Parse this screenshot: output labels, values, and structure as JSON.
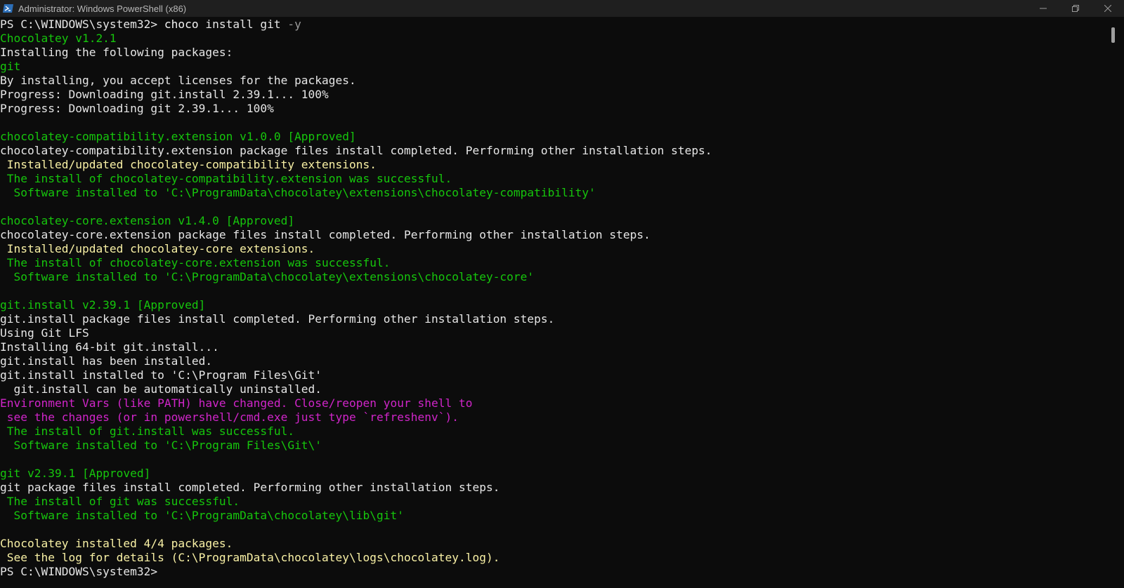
{
  "window": {
    "title": "Administrator: Windows PowerShell (x86)",
    "controls": {
      "minimize_icon": "minimize-icon",
      "restore_icon": "restore-icon",
      "close_icon": "close-icon"
    }
  },
  "colors": {
    "background": "#0c0c0c",
    "default_text": "#e6e6e6",
    "green": "#16c60c",
    "yellow": "#f9f1a5",
    "magenta": "#d025c9",
    "param": "#9a9a9a"
  },
  "console": {
    "lines": [
      {
        "segments": [
          {
            "text": "PS C:\\WINDOWS\\system32> ",
            "style": "default"
          },
          {
            "text": "choco",
            "style": "cmd"
          },
          {
            "text": " install git ",
            "style": "default"
          },
          {
            "text": "-y",
            "style": "param"
          }
        ]
      },
      {
        "segments": [
          {
            "text": "Chocolatey v1.2.1",
            "style": "green"
          }
        ]
      },
      {
        "segments": [
          {
            "text": "Installing the following packages:",
            "style": "default"
          }
        ]
      },
      {
        "segments": [
          {
            "text": "git",
            "style": "green"
          }
        ]
      },
      {
        "segments": [
          {
            "text": "By installing, you accept licenses for the packages.",
            "style": "default"
          }
        ]
      },
      {
        "segments": [
          {
            "text": "Progress: Downloading git.install 2.39.1... 100%",
            "style": "default"
          }
        ]
      },
      {
        "segments": [
          {
            "text": "Progress: Downloading git 2.39.1... 100%",
            "style": "default"
          }
        ]
      },
      {
        "segments": [
          {
            "text": "",
            "style": "default"
          }
        ]
      },
      {
        "segments": [
          {
            "text": "chocolatey-compatibility.extension v1.0.0 [Approved]",
            "style": "green"
          }
        ]
      },
      {
        "segments": [
          {
            "text": "chocolatey-compatibility.extension package files install completed. Performing other installation steps.",
            "style": "default"
          }
        ]
      },
      {
        "segments": [
          {
            "text": " Installed/updated chocolatey-compatibility extensions.",
            "style": "yellow"
          }
        ]
      },
      {
        "segments": [
          {
            "text": " The install of chocolatey-compatibility.extension was successful.",
            "style": "green"
          }
        ]
      },
      {
        "segments": [
          {
            "text": "  Software installed to 'C:\\ProgramData\\chocolatey\\extensions\\chocolatey-compatibility'",
            "style": "green"
          }
        ]
      },
      {
        "segments": [
          {
            "text": "",
            "style": "default"
          }
        ]
      },
      {
        "segments": [
          {
            "text": "chocolatey-core.extension v1.4.0 [Approved]",
            "style": "green"
          }
        ]
      },
      {
        "segments": [
          {
            "text": "chocolatey-core.extension package files install completed. Performing other installation steps.",
            "style": "default"
          }
        ]
      },
      {
        "segments": [
          {
            "text": " Installed/updated chocolatey-core extensions.",
            "style": "yellow"
          }
        ]
      },
      {
        "segments": [
          {
            "text": " The install of chocolatey-core.extension was successful.",
            "style": "green"
          }
        ]
      },
      {
        "segments": [
          {
            "text": "  Software installed to 'C:\\ProgramData\\chocolatey\\extensions\\chocolatey-core'",
            "style": "green"
          }
        ]
      },
      {
        "segments": [
          {
            "text": "",
            "style": "default"
          }
        ]
      },
      {
        "segments": [
          {
            "text": "git.install v2.39.1 [Approved]",
            "style": "green"
          }
        ]
      },
      {
        "segments": [
          {
            "text": "git.install package files install completed. Performing other installation steps.",
            "style": "default"
          }
        ]
      },
      {
        "segments": [
          {
            "text": "Using Git LFS",
            "style": "default"
          }
        ]
      },
      {
        "segments": [
          {
            "text": "Installing 64-bit git.install...",
            "style": "default"
          }
        ]
      },
      {
        "segments": [
          {
            "text": "git.install has been installed.",
            "style": "default"
          }
        ]
      },
      {
        "segments": [
          {
            "text": "git.install installed to 'C:\\Program Files\\Git'",
            "style": "default"
          }
        ]
      },
      {
        "segments": [
          {
            "text": "  git.install can be automatically uninstalled.",
            "style": "default"
          }
        ]
      },
      {
        "segments": [
          {
            "text": "Environment Vars (like PATH) have changed. Close/reopen your shell to",
            "style": "magenta"
          }
        ]
      },
      {
        "segments": [
          {
            "text": " see the changes (or in powershell/cmd.exe just type `refreshenv`).",
            "style": "magenta"
          }
        ]
      },
      {
        "segments": [
          {
            "text": " The install of git.install was successful.",
            "style": "green"
          }
        ]
      },
      {
        "segments": [
          {
            "text": "  Software installed to 'C:\\Program Files\\Git\\'",
            "style": "green"
          }
        ]
      },
      {
        "segments": [
          {
            "text": "",
            "style": "default"
          }
        ]
      },
      {
        "segments": [
          {
            "text": "git v2.39.1 [Approved]",
            "style": "green"
          }
        ]
      },
      {
        "segments": [
          {
            "text": "git package files install completed. Performing other installation steps.",
            "style": "default"
          }
        ]
      },
      {
        "segments": [
          {
            "text": " The install of git was successful.",
            "style": "green"
          }
        ]
      },
      {
        "segments": [
          {
            "text": "  Software installed to 'C:\\ProgramData\\chocolatey\\lib\\git'",
            "style": "green"
          }
        ]
      },
      {
        "segments": [
          {
            "text": "",
            "style": "default"
          }
        ]
      },
      {
        "segments": [
          {
            "text": "Chocolatey installed 4/4 packages.",
            "style": "yellow"
          }
        ]
      },
      {
        "segments": [
          {
            "text": " See the log for details (C:\\ProgramData\\chocolatey\\logs\\chocolatey.log).",
            "style": "yellow"
          }
        ]
      },
      {
        "segments": [
          {
            "text": "PS C:\\WINDOWS\\system32> ",
            "style": "default"
          }
        ]
      }
    ]
  }
}
